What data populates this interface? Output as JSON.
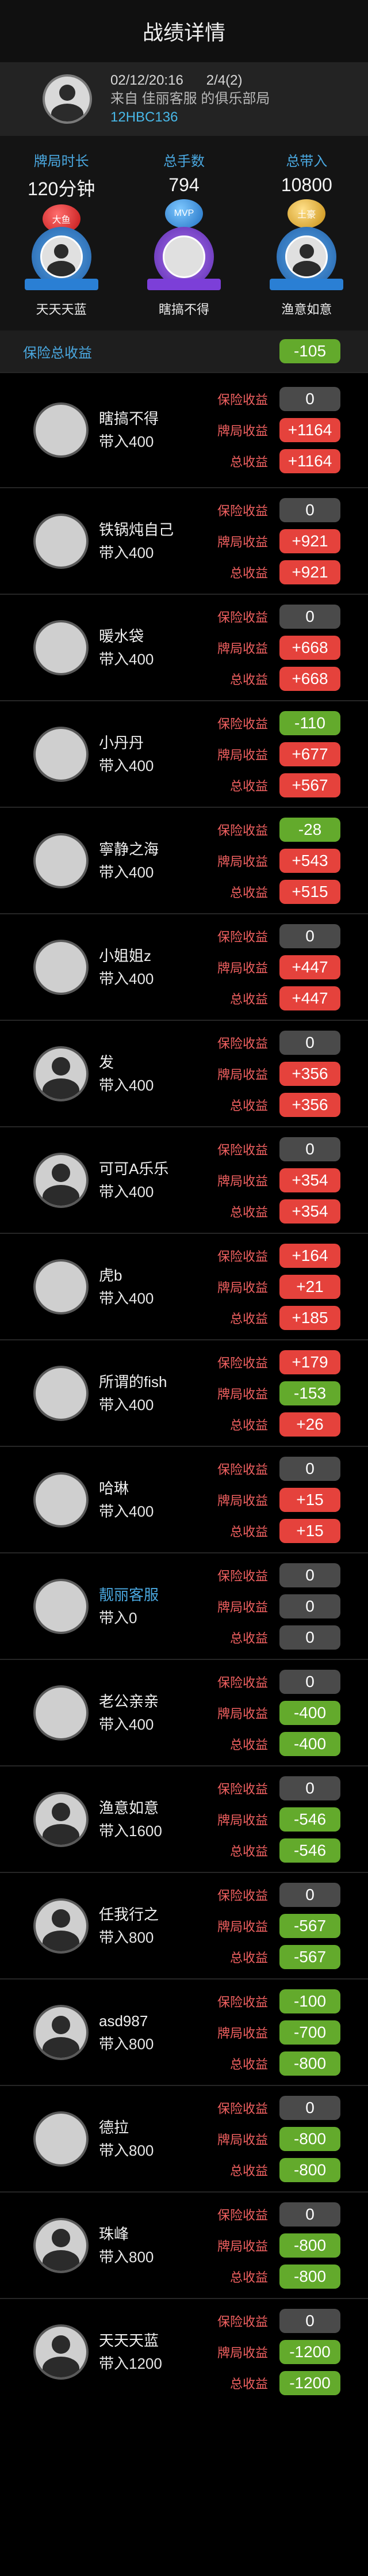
{
  "title": "战绩详情",
  "game": {
    "date": "02/12/20:16",
    "round": "2/4(2)",
    "source": "来自 佳丽客服 的俱乐部局",
    "code": "12HBC136"
  },
  "stats": [
    {
      "label": "牌局时长",
      "value": "120分钟",
      "badge": "大鱼",
      "badge_color": "red"
    },
    {
      "label": "总手数",
      "value": "794",
      "badge": "MVP",
      "badge_color": "blue"
    },
    {
      "label": "总带入",
      "value": "10800",
      "badge": "土豪",
      "badge_color": "gold"
    }
  ],
  "honors": [
    {
      "name": "天天天蓝",
      "medal": "blue"
    },
    {
      "name": "瞎搞不得",
      "medal": "purple"
    },
    {
      "name": "渔意如意",
      "medal": "blue"
    }
  ],
  "insurance_total": {
    "label": "保险总收益",
    "value": "-105",
    "color": "green"
  },
  "row_labels": {
    "insurance": "保险收益",
    "hand": "牌局收益",
    "total": "总收益"
  },
  "players": [
    {
      "name": "瞎搞不得",
      "buyin": "带入400",
      "avatar": "photo",
      "insurance": {
        "v": "0",
        "c": "grey"
      },
      "hand": {
        "v": "+1164",
        "c": "red"
      },
      "total": {
        "v": "+1164",
        "c": "red"
      }
    },
    {
      "name": "铁锅炖自己",
      "buyin": "带入400",
      "avatar": "yellow",
      "insurance": {
        "v": "0",
        "c": "grey"
      },
      "hand": {
        "v": "+921",
        "c": "red"
      },
      "total": {
        "v": "+921",
        "c": "red"
      }
    },
    {
      "name": "暖水袋",
      "buyin": "带入400",
      "avatar": "sea",
      "insurance": {
        "v": "0",
        "c": "grey"
      },
      "hand": {
        "v": "+668",
        "c": "red"
      },
      "total": {
        "v": "+668",
        "c": "red"
      }
    },
    {
      "name": "小丹丹",
      "buyin": "带入400",
      "avatar": "cat",
      "insurance": {
        "v": "-110",
        "c": "green"
      },
      "hand": {
        "v": "+677",
        "c": "red"
      },
      "total": {
        "v": "+567",
        "c": "red"
      }
    },
    {
      "name": "寧静之海",
      "buyin": "带入400",
      "avatar": "wave",
      "insurance": {
        "v": "-28",
        "c": "green"
      },
      "hand": {
        "v": "+543",
        "c": "red"
      },
      "total": {
        "v": "+515",
        "c": "red"
      }
    },
    {
      "name": "小姐姐z",
      "buyin": "带入400",
      "avatar": "girl",
      "insurance": {
        "v": "0",
        "c": "grey"
      },
      "hand": {
        "v": "+447",
        "c": "red"
      },
      "total": {
        "v": "+447",
        "c": "red"
      }
    },
    {
      "name": "发",
      "buyin": "带入400",
      "avatar": "default",
      "insurance": {
        "v": "0",
        "c": "grey"
      },
      "hand": {
        "v": "+356",
        "c": "red"
      },
      "total": {
        "v": "+356",
        "c": "red"
      }
    },
    {
      "name": "可可A乐乐",
      "buyin": "带入400",
      "avatar": "default",
      "insurance": {
        "v": "0",
        "c": "grey"
      },
      "hand": {
        "v": "+354",
        "c": "red"
      },
      "total": {
        "v": "+354",
        "c": "red"
      }
    },
    {
      "name": "虎b",
      "buyin": "带入400",
      "avatar": "pink",
      "insurance": {
        "v": "+164",
        "c": "red"
      },
      "hand": {
        "v": "+21",
        "c": "red"
      },
      "total": {
        "v": "+185",
        "c": "red"
      }
    },
    {
      "name": "所谓的fish",
      "buyin": "带入400",
      "avatar": "white",
      "insurance": {
        "v": "+179",
        "c": "red"
      },
      "hand": {
        "v": "-153",
        "c": "green"
      },
      "total": {
        "v": "+26",
        "c": "red"
      }
    },
    {
      "name": "哈琳",
      "buyin": "带入400",
      "avatar": "dark",
      "insurance": {
        "v": "0",
        "c": "grey"
      },
      "hand": {
        "v": "+15",
        "c": "red"
      },
      "total": {
        "v": "+15",
        "c": "red"
      }
    },
    {
      "name": "靓丽客服",
      "buyin": "带入0",
      "avatar": "flower",
      "highlight": true,
      "insurance": {
        "v": "0",
        "c": "grey"
      },
      "hand": {
        "v": "0",
        "c": "grey"
      },
      "total": {
        "v": "0",
        "c": "grey"
      }
    },
    {
      "name": "老公亲亲",
      "buyin": "带入400",
      "avatar": "bride",
      "insurance": {
        "v": "0",
        "c": "grey"
      },
      "hand": {
        "v": "-400",
        "c": "green"
      },
      "total": {
        "v": "-400",
        "c": "green"
      }
    },
    {
      "name": "渔意如意",
      "buyin": "带入1600",
      "avatar": "default",
      "insurance": {
        "v": "0",
        "c": "grey"
      },
      "hand": {
        "v": "-546",
        "c": "green"
      },
      "total": {
        "v": "-546",
        "c": "green"
      }
    },
    {
      "name": "任我行之",
      "buyin": "带入800",
      "avatar": "default",
      "insurance": {
        "v": "0",
        "c": "grey"
      },
      "hand": {
        "v": "-567",
        "c": "green"
      },
      "total": {
        "v": "-567",
        "c": "green"
      }
    },
    {
      "name": "asd987",
      "buyin": "带入800",
      "avatar": "default",
      "insurance": {
        "v": "-100",
        "c": "green"
      },
      "hand": {
        "v": "-700",
        "c": "green"
      },
      "total": {
        "v": "-800",
        "c": "green"
      }
    },
    {
      "name": "德拉",
      "buyin": "带入800",
      "avatar": "forest",
      "insurance": {
        "v": "0",
        "c": "grey"
      },
      "hand": {
        "v": "-800",
        "c": "green"
      },
      "total": {
        "v": "-800",
        "c": "green"
      }
    },
    {
      "name": "珠峰",
      "buyin": "带入800",
      "avatar": "default",
      "insurance": {
        "v": "0",
        "c": "grey"
      },
      "hand": {
        "v": "-800",
        "c": "green"
      },
      "total": {
        "v": "-800",
        "c": "green"
      }
    },
    {
      "name": "天天天蓝",
      "buyin": "带入1200",
      "avatar": "default",
      "insurance": {
        "v": "0",
        "c": "grey"
      },
      "hand": {
        "v": "-1200",
        "c": "green"
      },
      "total": {
        "v": "-1200",
        "c": "green"
      }
    }
  ]
}
